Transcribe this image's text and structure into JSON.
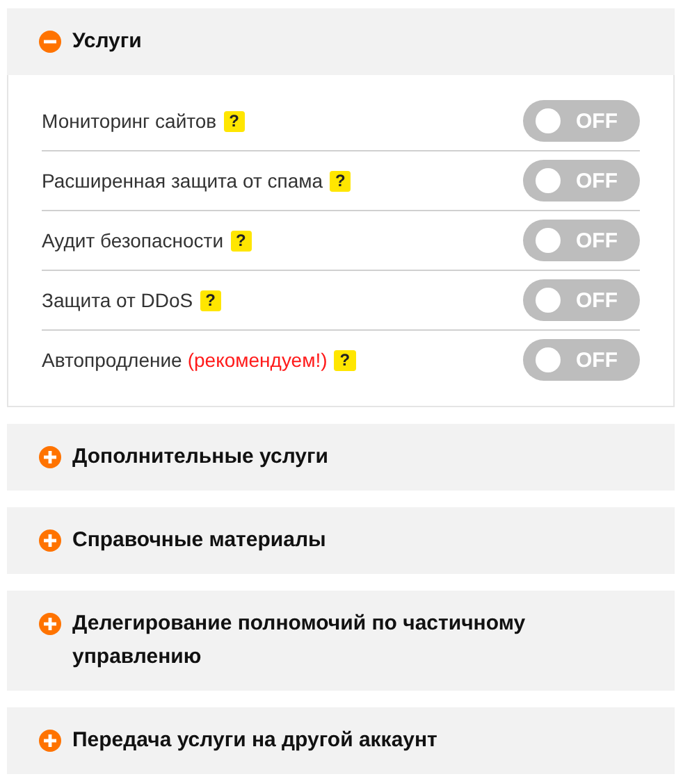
{
  "sections": [
    {
      "title": "Услуги",
      "expanded": true,
      "items": [
        {
          "label": "Мониторинг сайтов",
          "help": "?",
          "on": false,
          "toggle_text": "OFF"
        },
        {
          "label": "Расширенная защита от спама",
          "help": "?",
          "on": false,
          "toggle_text": "OFF"
        },
        {
          "label": "Аудит безопасности",
          "help": "?",
          "on": false,
          "toggle_text": "OFF"
        },
        {
          "label": "Защита от DDoS",
          "help": "?",
          "on": false,
          "toggle_text": "OFF"
        },
        {
          "label": "Автопродление",
          "note": "(рекомендуем!)",
          "help": "?",
          "on": false,
          "toggle_text": "OFF"
        }
      ]
    },
    {
      "title": "Дополнительные услуги",
      "expanded": false
    },
    {
      "title": "Справочные материалы",
      "expanded": false
    },
    {
      "title": "Делегирование полномочий по частичному управлению",
      "expanded": false
    },
    {
      "title": "Передача услуги на другой аккаунт",
      "expanded": false
    }
  ]
}
